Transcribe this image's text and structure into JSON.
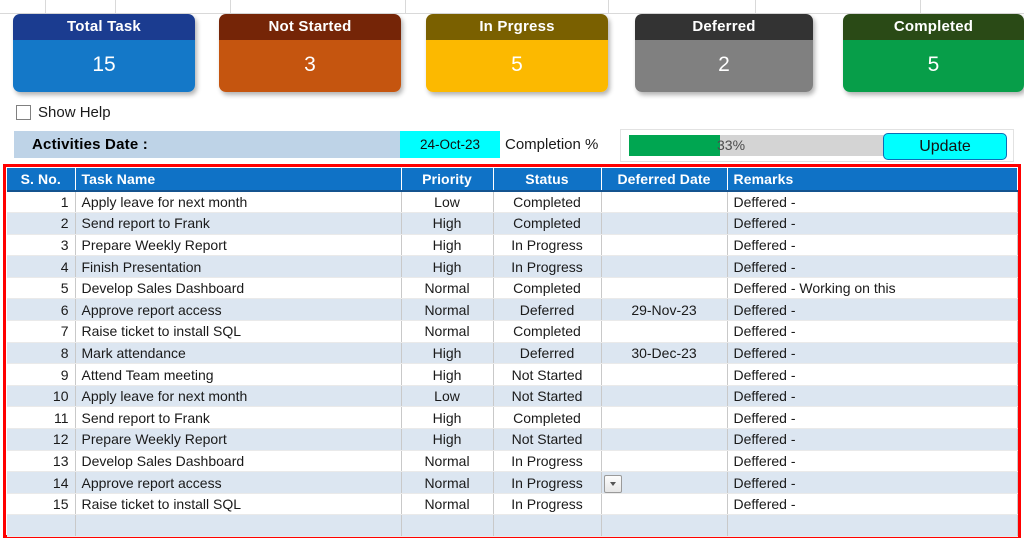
{
  "kpi_cards": [
    {
      "title": "Total Task",
      "value": "15",
      "head_color": "#1b3c90",
      "body_color": "#1478c8"
    },
    {
      "title": "Not Started",
      "value": "3",
      "head_color": "#752507",
      "body_color": "#c5550f"
    },
    {
      "title": "In Prgress",
      "value": "5",
      "head_color": "#7a6000",
      "body_color": "#fcb900"
    },
    {
      "title": "Deferred",
      "value": "2",
      "head_color": "#333333",
      "body_color": "#808080"
    },
    {
      "title": "Completed",
      "value": "5",
      "head_color": "#2a4a16",
      "body_color": "#079e49"
    }
  ],
  "controls": {
    "show_help_label": "Show Help",
    "show_help_checked": false,
    "activities_date_label": "Activities Date :",
    "activities_date_value": "24-Oct-23",
    "completion_label": "Completion %",
    "completion_percent_text": "33%",
    "completion_percent": 33,
    "update_button_label": "Update",
    "progress_fill_color": "#00a651",
    "date_highlight_color": "#00ffff",
    "update_button_color": "#00ffff"
  },
  "table": {
    "columns": [
      "S. No.",
      "Task Name",
      "Priority",
      "Status",
      "Deferred Date",
      "Remarks"
    ],
    "rows": [
      {
        "sno": "1",
        "task": "Apply leave for next month",
        "priority": "Low",
        "status": "Completed",
        "deferred_date": "",
        "remarks": "Deffered -"
      },
      {
        "sno": "2",
        "task": "Send report to Frank",
        "priority": "High",
        "status": "Completed",
        "deferred_date": "",
        "remarks": "Deffered -"
      },
      {
        "sno": "3",
        "task": "Prepare Weekly Report",
        "priority": "High",
        "status": "In Progress",
        "deferred_date": "",
        "remarks": "Deffered -"
      },
      {
        "sno": "4",
        "task": "Finish Presentation",
        "priority": "High",
        "status": "In Progress",
        "deferred_date": "",
        "remarks": "Deffered -"
      },
      {
        "sno": "5",
        "task": "Develop Sales Dashboard",
        "priority": "Normal",
        "status": "Completed",
        "deferred_date": "",
        "remarks": "Deffered - Working on this"
      },
      {
        "sno": "6",
        "task": "Approve report access",
        "priority": "Normal",
        "status": "Deferred",
        "deferred_date": "29-Nov-23",
        "remarks": "Deffered -"
      },
      {
        "sno": "7",
        "task": "Raise ticket to install SQL",
        "priority": "Normal",
        "status": "Completed",
        "deferred_date": "",
        "remarks": "Deffered -"
      },
      {
        "sno": "8",
        "task": "Mark attendance",
        "priority": "High",
        "status": "Deferred",
        "deferred_date": "30-Dec-23",
        "remarks": "Deffered -"
      },
      {
        "sno": "9",
        "task": "Attend Team meeting",
        "priority": "High",
        "status": "Not Started",
        "deferred_date": "",
        "remarks": "Deffered -"
      },
      {
        "sno": "10",
        "task": "Apply leave for next month",
        "priority": "Low",
        "status": "Not Started",
        "deferred_date": "",
        "remarks": "Deffered -"
      },
      {
        "sno": "11",
        "task": "Send report to Frank",
        "priority": "High",
        "status": "Completed",
        "deferred_date": "",
        "remarks": "Deffered -"
      },
      {
        "sno": "12",
        "task": "Prepare Weekly Report",
        "priority": "High",
        "status": "Not Started",
        "deferred_date": "",
        "remarks": "Deffered -"
      },
      {
        "sno": "13",
        "task": "Develop Sales Dashboard",
        "priority": "Normal",
        "status": "In Progress",
        "deferred_date": "",
        "remarks": "Deffered -"
      },
      {
        "sno": "14",
        "task": "Approve report access",
        "priority": "Normal",
        "status": "In Progress",
        "deferred_date": "",
        "remarks": "Deffered -",
        "has_dropdown": true
      },
      {
        "sno": "15",
        "task": "Raise ticket to install SQL",
        "priority": "Normal",
        "status": "In Progress",
        "deferred_date": "",
        "remarks": "Deffered -"
      },
      {
        "sno": "",
        "task": "",
        "priority": "",
        "status": "",
        "deferred_date": "",
        "remarks": ""
      }
    ]
  },
  "theme": {
    "header_color": "#0f72c6",
    "band_color": "#dce6f1",
    "frame_color": "#ff0000"
  }
}
